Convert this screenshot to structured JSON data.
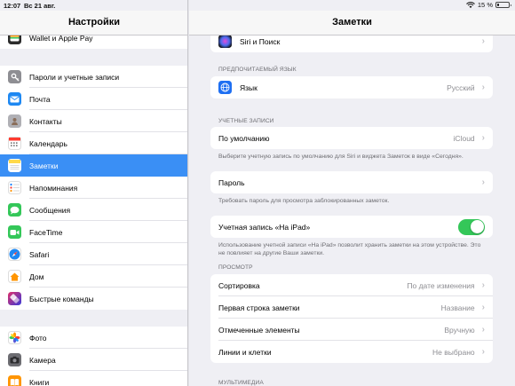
{
  "status_bar": {
    "time": "12:07",
    "date": "Вс 21 авг.",
    "battery": "15 %",
    "battery_level": 0.15
  },
  "sidebar": {
    "title": "Настройки",
    "group_top": [
      {
        "label": "Wallet и Apple Pay",
        "icon": "wallet-icon",
        "color": "#2b2b2b"
      }
    ],
    "group_main": [
      {
        "label": "Пароли и учетные записи",
        "icon": "key-icon",
        "color": "#8e8e93"
      },
      {
        "label": "Почта",
        "icon": "mail-icon",
        "color": "#1e88f2"
      },
      {
        "label": "Контакты",
        "icon": "contacts-icon",
        "color": "#a8a8ad"
      },
      {
        "label": "Календарь",
        "icon": "calendar-icon",
        "color": "#ffffff"
      },
      {
        "label": "Заметки",
        "icon": "notes-icon",
        "color": "#ffd94a",
        "selected": true
      },
      {
        "label": "Напоминания",
        "icon": "reminders-icon",
        "color": "#ffffff"
      },
      {
        "label": "Сообщения",
        "icon": "messages-icon",
        "color": "#34c759"
      },
      {
        "label": "FaceTime",
        "icon": "facetime-icon",
        "color": "#34c759"
      },
      {
        "label": "Safari",
        "icon": "safari-icon",
        "color": "#1e88f2"
      },
      {
        "label": "Дом",
        "icon": "home-icon",
        "color": "#ff9500"
      },
      {
        "label": "Быстрые команды",
        "icon": "shortcuts-icon",
        "color": "#5b4bd8"
      }
    ],
    "group_media": [
      {
        "label": "Фото",
        "icon": "photos-icon",
        "color": "#ffffff"
      },
      {
        "label": "Камера",
        "icon": "camera-icon",
        "color": "#6d6d72"
      },
      {
        "label": "Книги",
        "icon": "books-icon",
        "color": "#ff9500"
      }
    ]
  },
  "detail": {
    "title": "Заметки",
    "siri_row": {
      "label": "Siri и Поиск",
      "icon": "siri-icon"
    },
    "language_section": "ПРЕДПОЧИТАЕМЫЙ ЯЗЫК",
    "language_row": {
      "label": "Язык",
      "value": "Русский",
      "icon": "globe-icon"
    },
    "accounts_section": "УЧЕТНЫЕ ЗАПИСИ",
    "default_row": {
      "label": "По умолчанию",
      "value": "iCloud"
    },
    "default_footer": "Выберите учетную запись по умолчанию для Siri и виджета Заметок в виде «Сегодня».",
    "password_row": {
      "label": "Пароль"
    },
    "password_footer": "Требовать пароль для просмотра заблокированных заметок.",
    "ipad_account_row": {
      "label": "Учетная запись «На iPad»",
      "toggle_on": true
    },
    "ipad_account_footer": "Использование учетной записи «На iPad» позволит хранить заметки на этом устройстве. Это не повлияет на другие Ваши заметки.",
    "view_section": "ПРОСМОТР",
    "view_rows": [
      {
        "label": "Сортировка",
        "value": "По дате изменения"
      },
      {
        "label": "Первая строка заметки",
        "value": "Название"
      },
      {
        "label": "Отмеченные элементы",
        "value": "Вручную"
      },
      {
        "label": "Линии и клетки",
        "value": "Не выбрано"
      }
    ],
    "multimedia_section": "МУЛЬТИМЕДИА"
  }
}
